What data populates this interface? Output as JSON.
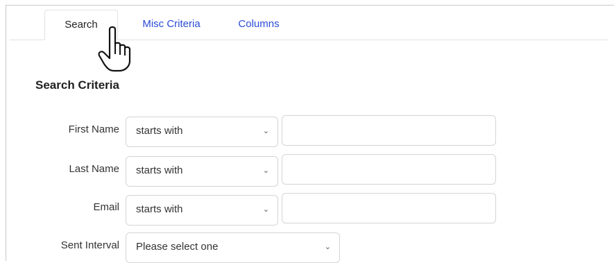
{
  "tabs": {
    "search": "Search",
    "misc": "Misc Criteria",
    "columns": "Columns"
  },
  "section_title": "Search Criteria",
  "rows": {
    "first_name": {
      "label": "First Name",
      "operator": "starts with",
      "value": ""
    },
    "last_name": {
      "label": "Last Name",
      "operator": "starts with",
      "value": ""
    },
    "email": {
      "label": "Email",
      "operator": "starts with",
      "value": ""
    },
    "sent_interval": {
      "label": "Sent Interval",
      "selected": "Please select one"
    }
  },
  "icons": {
    "cursor": "hand-pointer-icon",
    "dropdown": "chevron-down-icon"
  },
  "colors": {
    "link": "#2a4bd7",
    "border": "#d4d4d4"
  }
}
